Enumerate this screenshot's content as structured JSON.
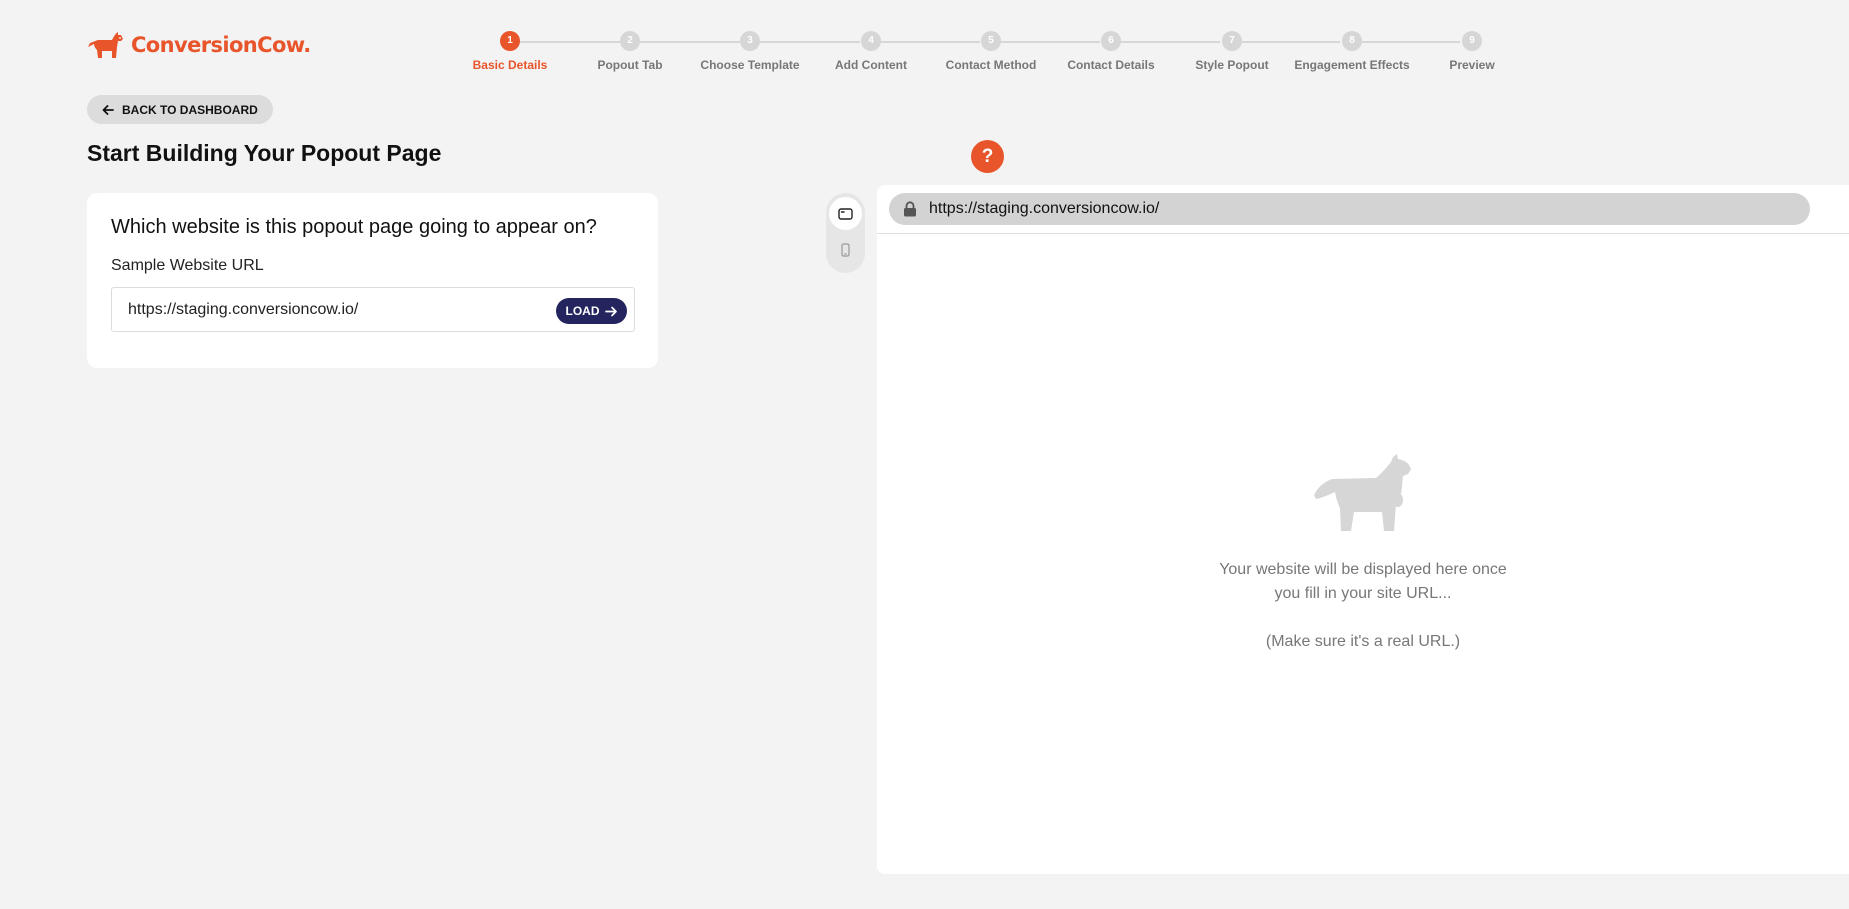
{
  "brand": {
    "name": "ConversionCow.",
    "accent_color": "#e8552b",
    "dark_color": "#24255e"
  },
  "stepper": {
    "active_step": 1,
    "steps": [
      {
        "number": "1",
        "label": "Basic Details"
      },
      {
        "number": "2",
        "label": "Popout Tab"
      },
      {
        "number": "3",
        "label": "Choose Template"
      },
      {
        "number": "4",
        "label": "Add Content"
      },
      {
        "number": "5",
        "label": "Contact Method"
      },
      {
        "number": "6",
        "label": "Contact Details"
      },
      {
        "number": "7",
        "label": "Style Popout"
      },
      {
        "number": "8",
        "label": "Engagement Effects"
      },
      {
        "number": "9",
        "label": "Preview"
      }
    ]
  },
  "header": {
    "back_label": "BACK TO DASHBOARD",
    "page_title": "Start Building Your Popout Page",
    "help_label": "?"
  },
  "form": {
    "question": "Which website is this popout page going to appear on?",
    "url_label": "Sample Website URL",
    "url_value": "https://staging.conversioncow.io/",
    "load_label": "LOAD"
  },
  "device_toggle": {
    "selected": "desktop",
    "options": [
      "desktop-icon",
      "mobile-icon"
    ]
  },
  "preview": {
    "address": "https://staging.conversioncow.io/",
    "placeholder_line1": "Your website will be displayed here once",
    "placeholder_line2": "you fill in your site URL...",
    "placeholder_note": "(Make sure it's a real URL.)"
  }
}
